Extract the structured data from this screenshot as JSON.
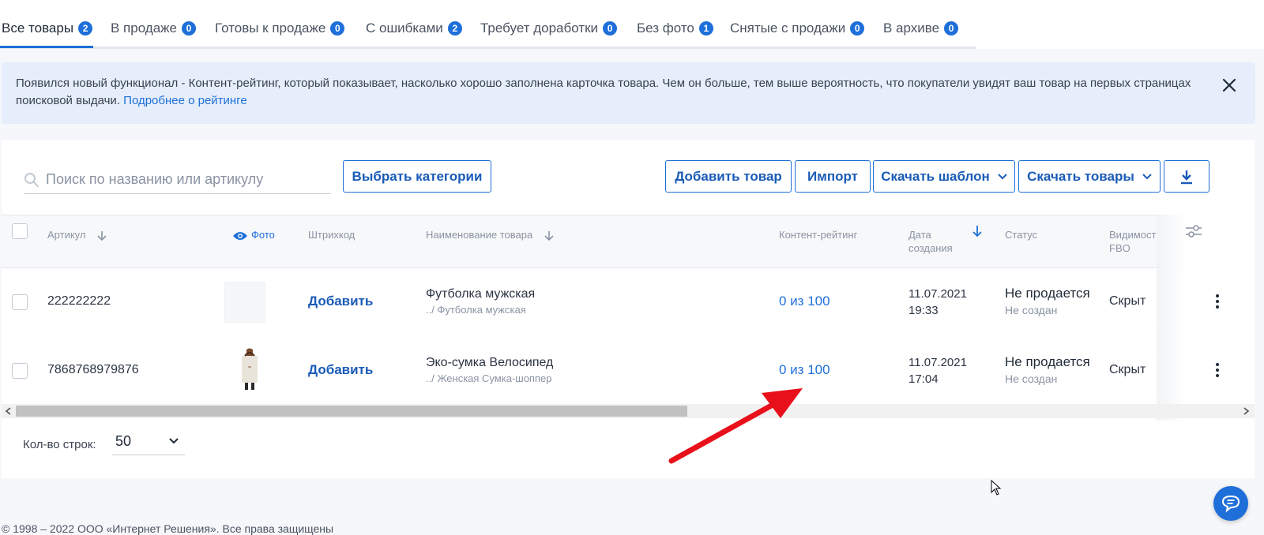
{
  "tabs": [
    {
      "label": "Все товары",
      "count": "2"
    },
    {
      "label": "В продаже",
      "count": "0"
    },
    {
      "label": "Готовы к продаже",
      "count": "0"
    },
    {
      "label": "С ошибками",
      "count": "2"
    },
    {
      "label": "Требует доработки",
      "count": "0"
    },
    {
      "label": "Без фото",
      "count": "1"
    },
    {
      "label": "Снятые с продажи",
      "count": "0"
    },
    {
      "label": "В архиве",
      "count": "0"
    }
  ],
  "notice": {
    "text": "Появился новый функционал - Контент-рейтинг, который показывает, насколько хорошо заполнена карточка товара. Чем он больше, тем выше вероятность, что покупатели увидят ваш товар на первых страницах поисковой выдачи.",
    "link": "Подробнее о рейтинге"
  },
  "toolbar": {
    "search_placeholder": "Поиск по названию или артикулу",
    "choose_categories": "Выбрать категории",
    "add_product": "Добавить товар",
    "import": "Импорт",
    "download_template": "Скачать шаблон",
    "download_products": "Скачать товары"
  },
  "table": {
    "headers": {
      "article": "Артикул",
      "photo": "Фото",
      "barcode": "Штрихкод",
      "name": "Наименование товара",
      "rating": "Контент-рейтинг",
      "date_line1": "Дата",
      "date_line2": "создания",
      "status": "Статус",
      "visibility_line1": "Видимост",
      "visibility_line2": "FBO"
    },
    "rows": [
      {
        "article": "222222222",
        "barcode": "Добавить",
        "name": "Футболка мужская",
        "category": "../ Футболка мужская",
        "rating": "0 из 100",
        "date": "11.07.2021",
        "time": "19:33",
        "status": "Не продается",
        "status_sub": "Не создан",
        "visibility": "Скрыт"
      },
      {
        "article": "7868768979876",
        "barcode": "Добавить",
        "name": "Эко-сумка Велосипед",
        "category": "../ Женская Сумка-шоппер",
        "rating": "0 из 100",
        "date": "11.07.2021",
        "time": "17:04",
        "status": "Не продается",
        "status_sub": "Не создан",
        "visibility": "Скрыт"
      }
    ]
  },
  "pagination": {
    "rows_label": "Кол-во строк:",
    "rows_value": "50"
  },
  "footer": {
    "copyright": "© 1998 – 2022 ООО «Интернет Решения». Все права защищены"
  },
  "colors": {
    "accent": "#1e6fd9",
    "annotation_arrow": "#e8101a"
  }
}
